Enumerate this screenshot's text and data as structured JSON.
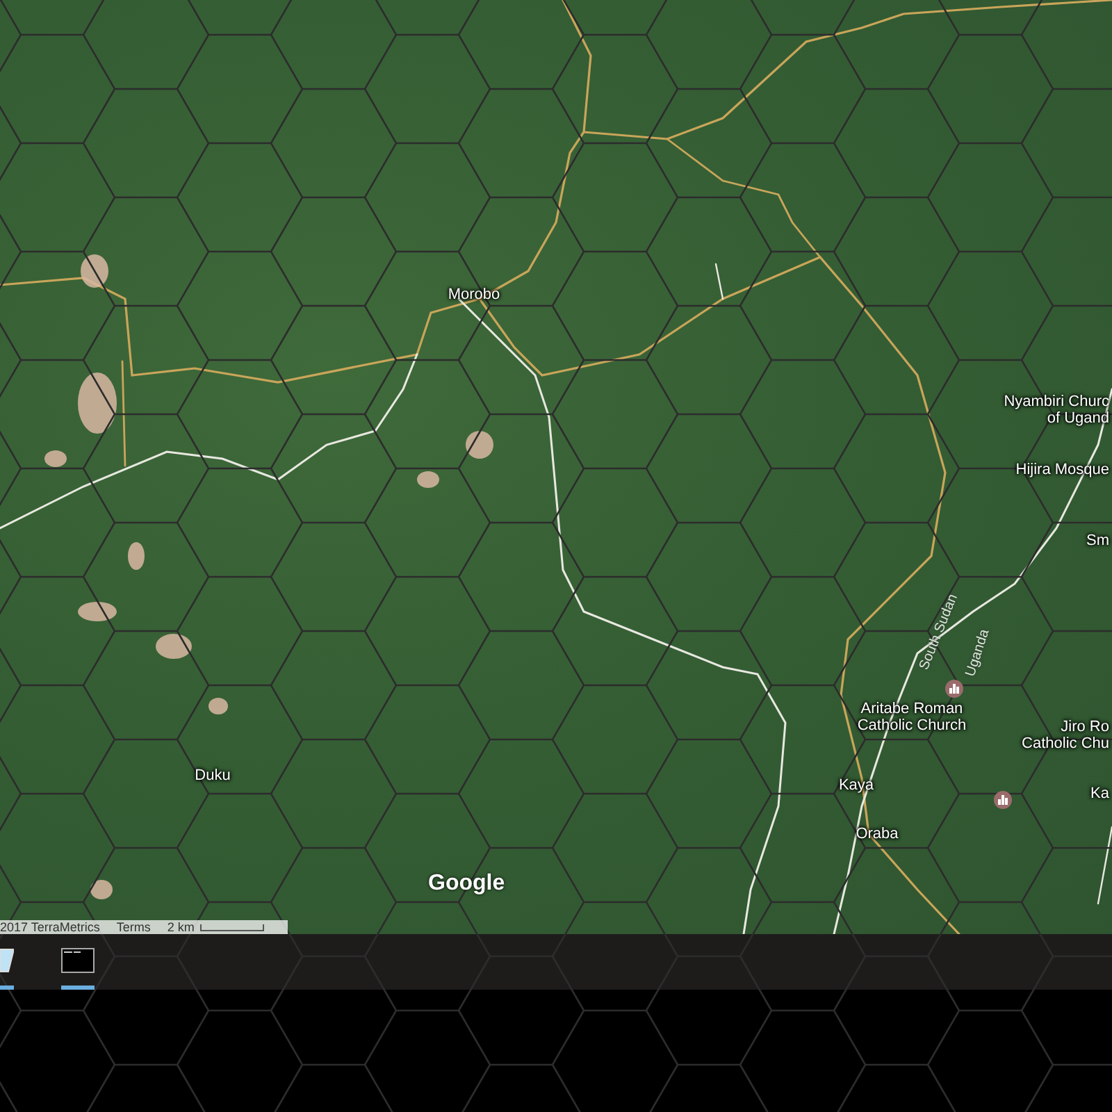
{
  "map": {
    "labels": [
      {
        "kind": "place",
        "lines": [
          "Morobo"
        ]
      },
      {
        "kind": "place",
        "lines": [
          "Duku"
        ]
      },
      {
        "kind": "place",
        "lines": [
          "Nyambiri Churc",
          "of Ugand"
        ]
      },
      {
        "kind": "place",
        "lines": [
          "Hijira Mosque"
        ]
      },
      {
        "kind": "place",
        "lines": [
          "Sm"
        ]
      },
      {
        "kind": "border",
        "lines": [
          "South Sudan"
        ]
      },
      {
        "kind": "border",
        "lines": [
          "Uganda"
        ]
      },
      {
        "kind": "place",
        "lines": [
          "Aritabe Roman",
          "Catholic Church"
        ]
      },
      {
        "kind": "place",
        "lines": [
          "Jiro Ro",
          "Catholic Chu"
        ]
      },
      {
        "kind": "place",
        "lines": [
          "Kaya"
        ]
      },
      {
        "kind": "place",
        "lines": [
          "Oraba"
        ]
      },
      {
        "kind": "place",
        "lines": [
          "Ka"
        ]
      }
    ],
    "logo": "Google",
    "attribution": {
      "copyright": "2017 TerraMetrics",
      "terms": "Terms",
      "scale": "2 km"
    }
  }
}
